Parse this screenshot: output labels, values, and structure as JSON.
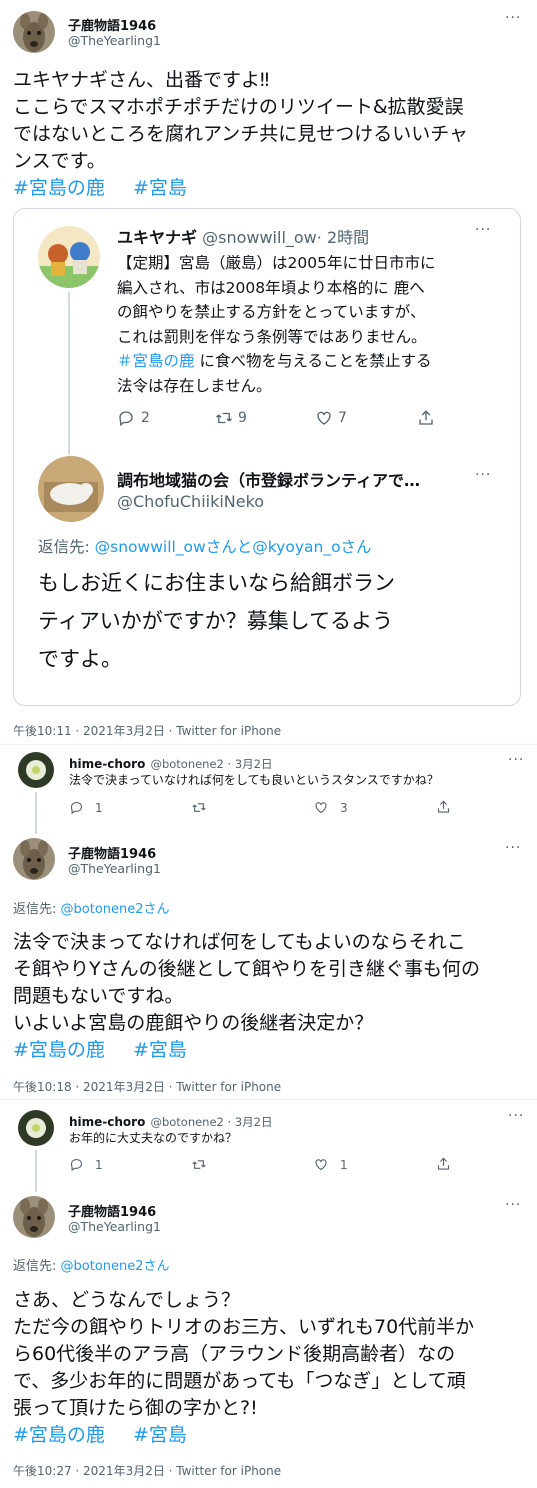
{
  "colors": {
    "link": "#1d9bf0",
    "muted": "#536471",
    "text": "#0f1419",
    "border": "#cfd9de",
    "thread": "#cfd9de"
  },
  "tweet1": {
    "name": "子鹿物語1946",
    "handle": "@TheYearling1",
    "lines": [
      "ユキヤナギさん、出番ですよ‼︎",
      "ここらでスマホポチポチだけのリツイート&拡散愛誤",
      "ではないところを腐れアンチ共に見せつけるいいチャ",
      "ンスです。"
    ],
    "hashtags": [
      "#宮島の鹿",
      "#宮島"
    ],
    "timestamp": "午後10:11 · 2021年3月2日 · Twitter for iPhone"
  },
  "quote": {
    "name": "ユキヤナギ",
    "handle": "@snowwill_ow",
    "time": "· 2時間",
    "lines": [
      "【定期】宮島（厳島）は2005年に廿日市市に",
      "編入され、市は2008年頃より本格的に 鹿へ",
      "の餌やりを禁止する方針をとっていますが、",
      "これは罰則を伴なう条例等ではありません。"
    ],
    "line5_tag": "＃宮島の鹿",
    "line5_rest": "に食べ物を与えることを禁止する",
    "line6": "法令は存在しません。",
    "replies": "2",
    "retweets": "9",
    "likes": "7",
    "reply": {
      "name": "調布地域猫の会（市登録ボランティアで…",
      "handle": "@ChofuChiikiNeko",
      "reply_to_prefix": "返信先: ",
      "reply_to_1": "@snowwill_owさん",
      "reply_to_and": "と",
      "reply_to_2": "@kyoyan_oさん",
      "lines": [
        "もしお近くにお住まいなら給餌ボラン",
        "ティアいかがですか？募集してるよう",
        "ですよ。"
      ]
    }
  },
  "reply1": {
    "name": "hime-choro",
    "handle": "@botonene2 · 3月2日",
    "text": "法令で決まっていなければ何をしても良いというスタンスですかね？",
    "replies": "1",
    "retweets": "",
    "likes": "3"
  },
  "tweet2": {
    "name": "子鹿物語1946",
    "handle": "@TheYearling1",
    "reply_prefix": "返信先: ",
    "reply_to": "@botonene2さん",
    "lines": [
      "法令で決まってなければ何をしてもよいのならそれこ",
      "そ餌やりYさんの後継として餌やりを引き継ぐ事も何の",
      "問題もないですね。",
      "いよいよ宮島の鹿餌やりの後継者決定か？"
    ],
    "hashtags": [
      "#宮島の鹿",
      "#宮島"
    ],
    "timestamp": "午後10:18 · 2021年3月2日 · Twitter for iPhone"
  },
  "reply2": {
    "name": "hime-choro",
    "handle": "@botonene2 · 3月2日",
    "text": "お年的に大丈夫なのですかね？",
    "replies": "1",
    "retweets": "",
    "likes": "1"
  },
  "tweet3": {
    "name": "子鹿物語1946",
    "handle": "@TheYearling1",
    "reply_prefix": "返信先: ",
    "reply_to": "@botonene2さん",
    "lines": [
      "さあ、どうなんでしょう？",
      "ただ今の餌やりトリオのお三方、いずれも70代前半か",
      "ら60代後半のアラ高（アラウンド後期高齢者）なの",
      "で、多少お年的に問題があっても「つなぎ」として頑",
      "張って頂けたら御の字かと?!"
    ],
    "hashtags": [
      "#宮島の鹿",
      "#宮島"
    ],
    "timestamp": "午後10:27 · 2021年3月2日 · Twitter for iPhone"
  }
}
